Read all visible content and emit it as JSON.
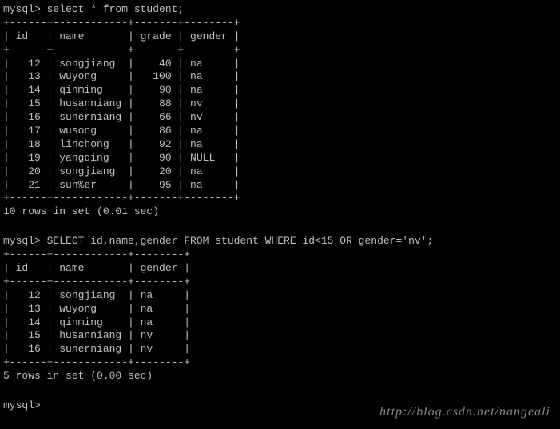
{
  "prompt1": "mysql> select * from student;",
  "table1": {
    "border_top": "+------+------------+-------+--------+",
    "header": "| id   | name       | grade | gender |",
    "border_mid": "+------+------------+-------+--------+",
    "rows": [
      "|   12 | songjiang  |    40 | na     |",
      "|   13 | wuyong     |   100 | na     |",
      "|   14 | qinming    |    90 | na     |",
      "|   15 | husanniang |    88 | nv     |",
      "|   16 | sunerniang |    66 | nv     |",
      "|   17 | wusong     |    86 | na     |",
      "|   18 | linchong   |    92 | na     |",
      "|   19 | yangqing   |    90 | NULL   |",
      "|   20 | songjiang  |    20 | na     |",
      "|   21 | sun%er     |    95 | na     |"
    ],
    "border_bottom": "+------+------------+-------+--------+"
  },
  "status1": "10 rows in set (0.01 sec)",
  "prompt2": "mysql> SELECT id,name,gender FROM student WHERE id<15 OR gender='nv';",
  "table2": {
    "border_top": "+------+------------+--------+",
    "header": "| id   | name       | gender |",
    "border_mid": "+------+------------+--------+",
    "rows": [
      "|   12 | songjiang  | na     |",
      "|   13 | wuyong     | na     |",
      "|   14 | qinming    | na     |",
      "|   15 | husanniang | nv     |",
      "|   16 | sunerniang | nv     |"
    ],
    "border_bottom": "+------+------------+--------+"
  },
  "status2": "5 rows in set (0.00 sec)",
  "prompt3": "mysql> ",
  "watermark": "http://blog.csdn.net/nangeali"
}
